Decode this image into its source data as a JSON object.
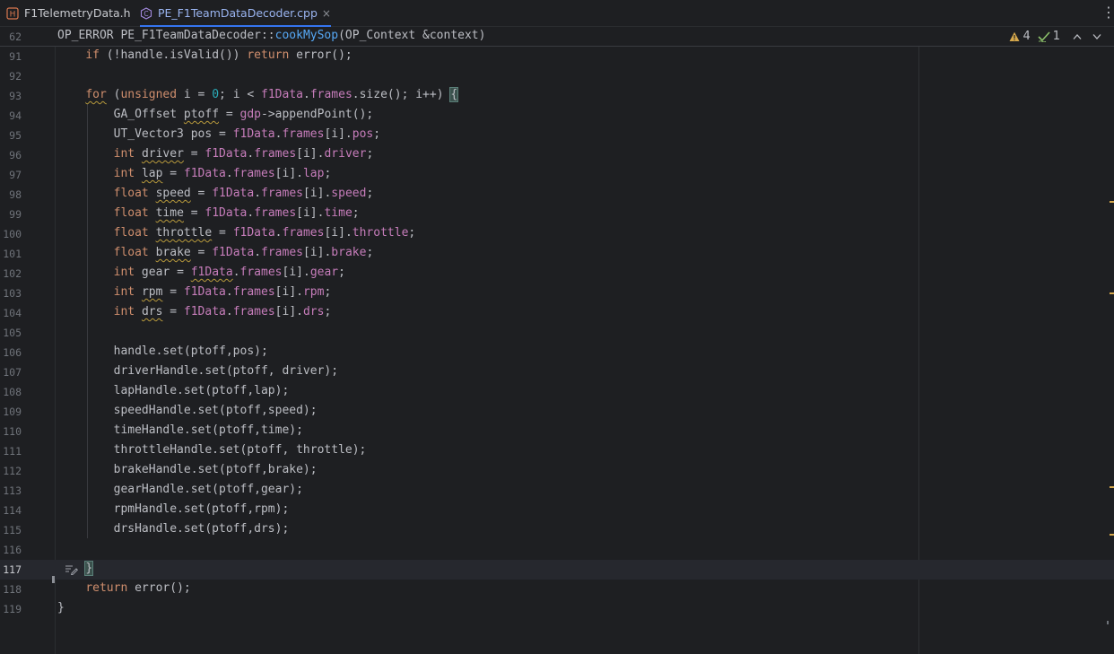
{
  "tabs": [
    {
      "label": "F1TelemetryData.h",
      "active": false,
      "icon": "header-file-icon"
    },
    {
      "label": "PE_F1TeamDataDecoder.cpp",
      "active": true,
      "icon": "cpp-file-icon",
      "close": "×"
    }
  ],
  "more_menu": "⋮",
  "sticky": {
    "line_number": "62",
    "text": "OP_ERROR PE_F1TeamDataDecoder::cookMySop(OP_Context &context)"
  },
  "inspections": {
    "warnings": "4",
    "weak_warnings": "1"
  },
  "colors": {
    "keyword": "#cf8e6d",
    "number": "#2aacb8",
    "field": "#c77dbb",
    "function": "#56a8f5",
    "accent": "#3574f0",
    "warning": "#d6a84c"
  },
  "lines": [
    {
      "n": "91",
      "text": "    if (!handle.isValid()) return error();"
    },
    {
      "n": "92",
      "text": ""
    },
    {
      "n": "93",
      "text": "    for (unsigned i = 0; i < f1Data.frames.size(); i++) {"
    },
    {
      "n": "94",
      "text": "        GA_Offset ptoff = gdp->appendPoint();"
    },
    {
      "n": "95",
      "text": "        UT_Vector3 pos = f1Data.frames[i].pos;"
    },
    {
      "n": "96",
      "text": "        int driver = f1Data.frames[i].driver;"
    },
    {
      "n": "97",
      "text": "        int lap = f1Data.frames[i].lap;"
    },
    {
      "n": "98",
      "text": "        float speed = f1Data.frames[i].speed;"
    },
    {
      "n": "99",
      "text": "        float time = f1Data.frames[i].time;"
    },
    {
      "n": "100",
      "text": "        float throttle = f1Data.frames[i].throttle;"
    },
    {
      "n": "101",
      "text": "        float brake = f1Data.frames[i].brake;"
    },
    {
      "n": "102",
      "text": "        int gear = f1Data.frames[i].gear;"
    },
    {
      "n": "103",
      "text": "        int rpm = f1Data.frames[i].rpm;"
    },
    {
      "n": "104",
      "text": "        int drs = f1Data.frames[i].drs;"
    },
    {
      "n": "105",
      "text": ""
    },
    {
      "n": "106",
      "text": "        handle.set(ptoff,pos);"
    },
    {
      "n": "107",
      "text": "        driverHandle.set(ptoff, driver);"
    },
    {
      "n": "108",
      "text": "        lapHandle.set(ptoff,lap);"
    },
    {
      "n": "109",
      "text": "        speedHandle.set(ptoff,speed);"
    },
    {
      "n": "110",
      "text": "        timeHandle.set(ptoff,time);"
    },
    {
      "n": "111",
      "text": "        throttleHandle.set(ptoff, throttle);"
    },
    {
      "n": "112",
      "text": "        brakeHandle.set(ptoff,brake);"
    },
    {
      "n": "113",
      "text": "        gearHandle.set(ptoff,gear);"
    },
    {
      "n": "114",
      "text": "        rpmHandle.set(ptoff,rpm);"
    },
    {
      "n": "115",
      "text": "        drsHandle.set(ptoff,drs);"
    },
    {
      "n": "116",
      "text": ""
    },
    {
      "n": "117",
      "text": "    }"
    },
    {
      "n": "118",
      "text": "    return error();"
    },
    {
      "n": "119",
      "text": "}"
    }
  ]
}
